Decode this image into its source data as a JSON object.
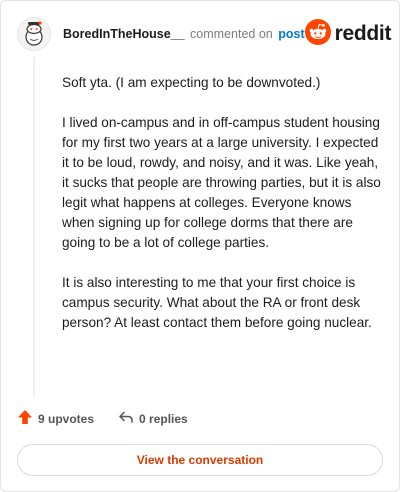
{
  "comment": {
    "username": "BoredInTheHouse__",
    "commented_on": "commented on",
    "post_link": "post",
    "paragraphs": [
      "Soft yta. (I am expecting to be downvoted.)",
      "I lived on-campus and in off-campus student housing for my first two years at a large university. I expected it to be loud, rowdy, and noisy, and it was. Like yeah, it sucks that people are throwing parties, but it is also legit what happens at colleges. Everyone knows when signing up for college dorms that there are going to be a lot of college parties.",
      "It is also interesting to me that your first choice is campus security. What about the RA or front desk person? At least contact them before going nuclear."
    ],
    "upvotes_label": "9 upvotes",
    "replies_label": "0 replies",
    "cta_label": "View the conversation"
  },
  "brand": {
    "wordmark": "reddit",
    "accent": "#ff4500"
  },
  "icons": {
    "avatar": "snoo-avatar-icon",
    "logo": "reddit-logo-icon",
    "upvote": "upvote-arrow-icon",
    "reply": "reply-arrow-icon"
  }
}
